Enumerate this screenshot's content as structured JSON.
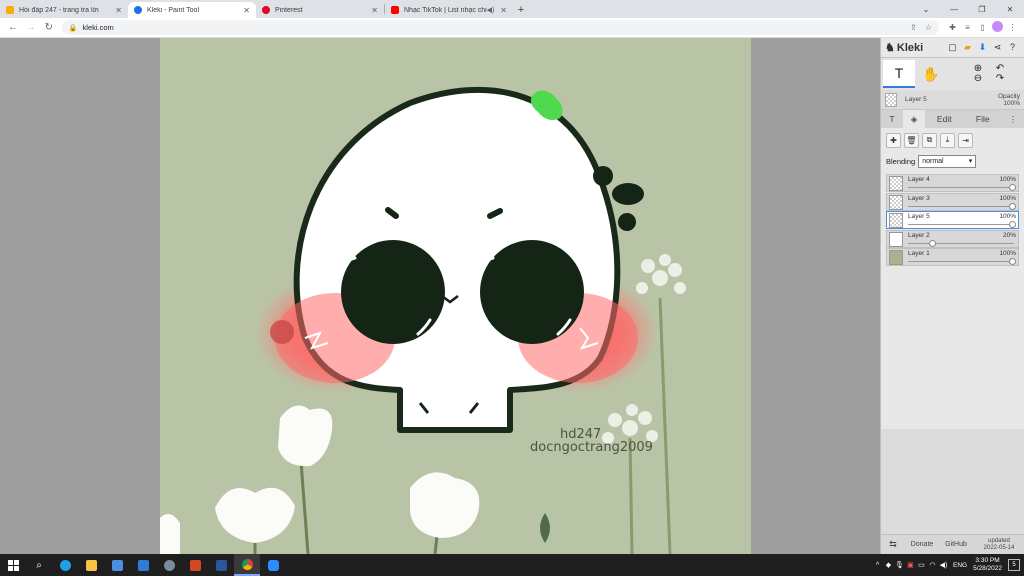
{
  "browser": {
    "tabs": [
      {
        "title": "Hỏi đáp 247 - trang tra lời",
        "favicon_color": "#f9ab00",
        "active": false
      },
      {
        "title": "Kleki - Paint Tool",
        "favicon_color": "#1a73e8",
        "active": true
      },
      {
        "title": "Pinterest",
        "favicon_color": "#e60023",
        "active": false
      },
      {
        "title": "Nhạc TikTok | List nhạc chill",
        "favicon_color": "#ff0000",
        "active": false
      }
    ],
    "new_tab": "+",
    "address": "kleki.com"
  },
  "canvas": {
    "background_color": "#b9c4a6",
    "watermark_line1": "hd247",
    "watermark_line2": "docngoctrang2009"
  },
  "panel": {
    "logo": "Kleki",
    "current_layer": {
      "name": "Layer 5",
      "opacity_label": "Opacity",
      "opacity_value": "100%"
    },
    "tabs": {
      "edit": "Edit",
      "file": "File"
    },
    "blending_label": "Blending",
    "blending_value": "normal",
    "layers": [
      {
        "name": "Layer 4",
        "opacity": "100%",
        "level": 1.0,
        "active": false
      },
      {
        "name": "Layer 3",
        "opacity": "100%",
        "level": 1.0,
        "active": false
      },
      {
        "name": "Layer 5",
        "opacity": "100%",
        "level": 1.0,
        "active": true
      },
      {
        "name": "Layer 2",
        "opacity": "20%",
        "level": 0.2,
        "active": false
      },
      {
        "name": "Layer 1",
        "opacity": "100%",
        "level": 1.0,
        "active": false
      }
    ],
    "footer": {
      "donate": "Donate",
      "github": "GitHub",
      "updated": "updated",
      "updated_date": "2022-05-14"
    }
  },
  "taskbar": {
    "language": "ENG",
    "time": "3:30 PM",
    "date": "5/28/2022",
    "notification_count": "5"
  }
}
